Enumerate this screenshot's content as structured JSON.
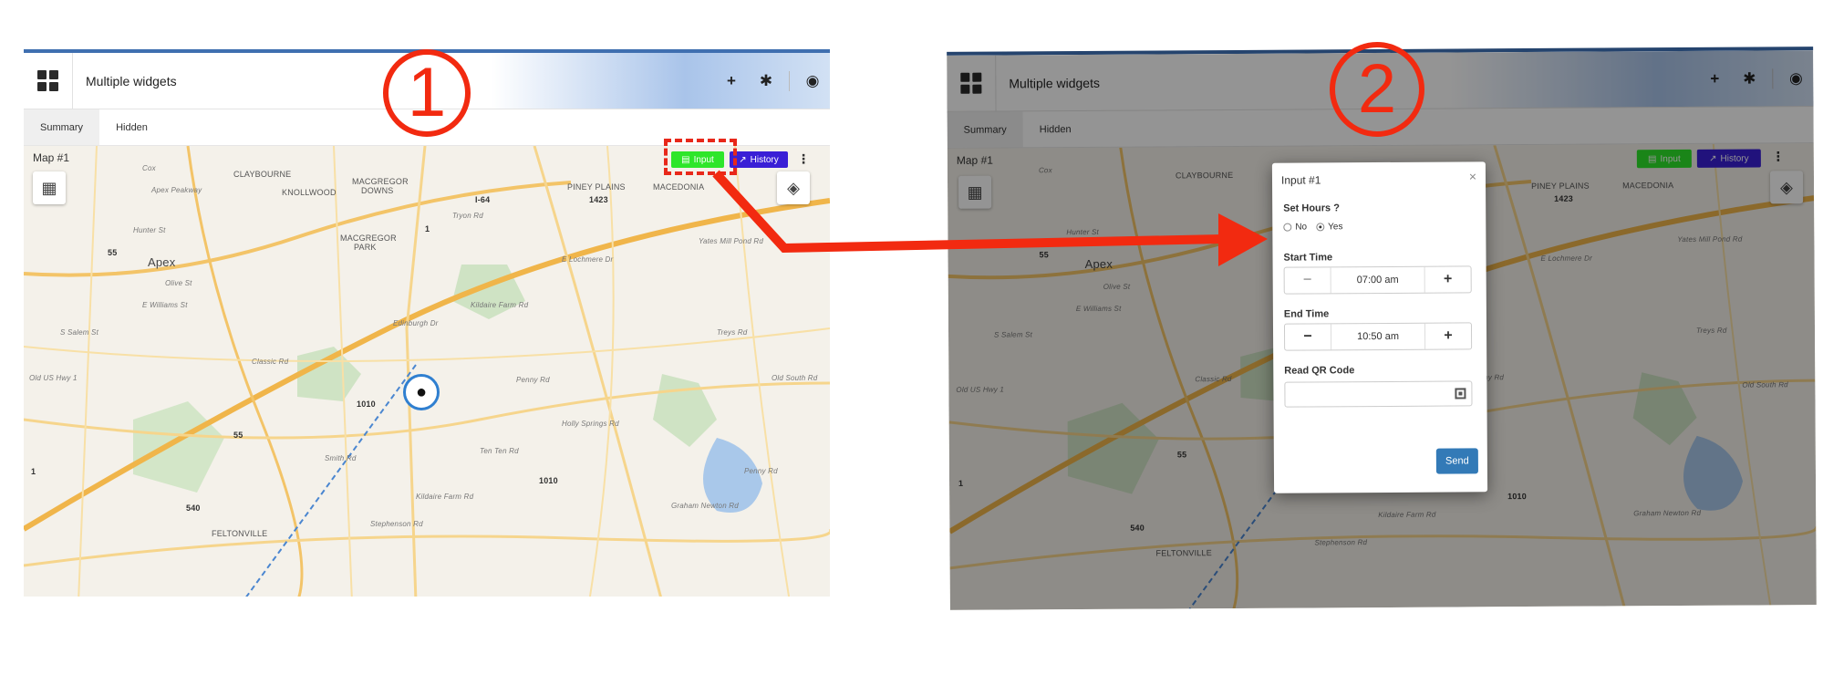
{
  "panel1": {
    "header": {
      "title": "Multiple widgets",
      "add_icon": "plus-icon",
      "settings_icon": "gear-icon",
      "view_icon": "eye-icon",
      "apps_icon": "grid-icon"
    },
    "tabs": [
      {
        "label": "Summary",
        "active": true
      },
      {
        "label": "Hidden",
        "active": false
      }
    ],
    "widget": {
      "title": "Map #1",
      "input_label": "Input",
      "history_label": "History",
      "input_color": "#2ee62a",
      "history_color": "#3a1fd6"
    },
    "map_labels": {
      "claybourne": "CLAYBOURNE",
      "knollwood": "KNOLLWOOD",
      "macgregor_downs_1": "MACGREGOR",
      "macgregor_downs_2": "DOWNS",
      "macgregor_park_1": "MACGREGOR",
      "macgregor_park_2": "PARK",
      "piney_plains": "PINEY PLAINS",
      "macedonia": "MACEDONIA",
      "apex": "Apex",
      "feltonville": "FELTONVILLE",
      "i64": "I-64",
      "n1423": "1423",
      "n55a": "55",
      "n55b": "55",
      "n1": "1",
      "n1b": "1",
      "n1010a": "1010",
      "n1010b": "1010",
      "n540": "540",
      "classic_rd": "Classic Rd",
      "penny_rd": "Penny Rd",
      "ten_ten_rd": "Ten Ten Rd",
      "smith_rd": "Smith Rd",
      "kildaire": "Kildaire Farm Rd",
      "tryon": "Tryon Rd",
      "apex_peakway": "Apex Peakway",
      "olive_st": "Olive St",
      "salem_st": "S Salem St",
      "yates_mill": "Yates Mill Pond Rd",
      "lochmere": "E Lochmere Dr",
      "holly_springs": "Holly Springs Rd",
      "stephenson": "Stephenson Rd",
      "grahamnewton": "Graham Newton Rd",
      "cox": "Cox",
      "hunter_st": "Hunter St",
      "williams": "E Williams St",
      "old_us1": "Old US Hwy 1",
      "edinburgh": "Edinburgh Dr",
      "penny_rd2": "Penny Rd",
      "ten_ten_2": "Ten Ten Rd",
      "treys_rd": "Treys Rd",
      "kildaire2": "Kildaire Farm Rd",
      "old_south": "Old South Rd"
    },
    "annotation_number": "1"
  },
  "panel2": {
    "header": {
      "title": "Multiple widgets"
    },
    "tabs": [
      {
        "label": "Summary"
      },
      {
        "label": "Hidden"
      }
    ],
    "widget": {
      "title": "Map #1",
      "input_label": "Input",
      "history_label": "History"
    },
    "modal": {
      "title": "Input #1",
      "close_glyph": "×",
      "set_hours_label": "Set Hours ?",
      "option_no": "No",
      "option_yes": "Yes",
      "selected_option": "Yes",
      "start_time_label": "Start Time",
      "start_time_value": "07:00 am",
      "end_time_label": "End Time",
      "end_time_value": "10:50 am",
      "qr_label": "Read QR Code",
      "qr_value": "",
      "send_label": "Send",
      "send_color": "#337ab7"
    },
    "map_labels": {
      "claybourne": "CLAYBOURNE",
      "piney_plains": "PINEY PLAINS",
      "macedonia": "MACEDONIA",
      "apex": "Apex",
      "feltonville": "FELTONVILLE",
      "n1423": "1423",
      "n55a": "55",
      "n55b": "55",
      "n1010a": "1010",
      "n1010b": "1010",
      "n540": "540",
      "n1": "1",
      "classic_rd": "Classic Rd",
      "cox": "Cox",
      "olive_st": "Olive St",
      "salem_st": "S Salem St",
      "yates_mill": "Yates Mill Pond Rd",
      "lochmere": "E Lochmere Dr",
      "penny_rd": "Penny Rd",
      "treys_rd": "Treys Rd",
      "old_south": "Old South Rd",
      "grahamnewton": "Graham Newton Rd",
      "kildaire": "Kildaire Farm Rd",
      "stephenson": "Stephenson Rd",
      "williams": "E Williams St",
      "hunter_st": "Hunter St",
      "old_us1": "Old US Hwy 1"
    },
    "annotation_number": "2"
  },
  "annotation_color": "#f22a10"
}
